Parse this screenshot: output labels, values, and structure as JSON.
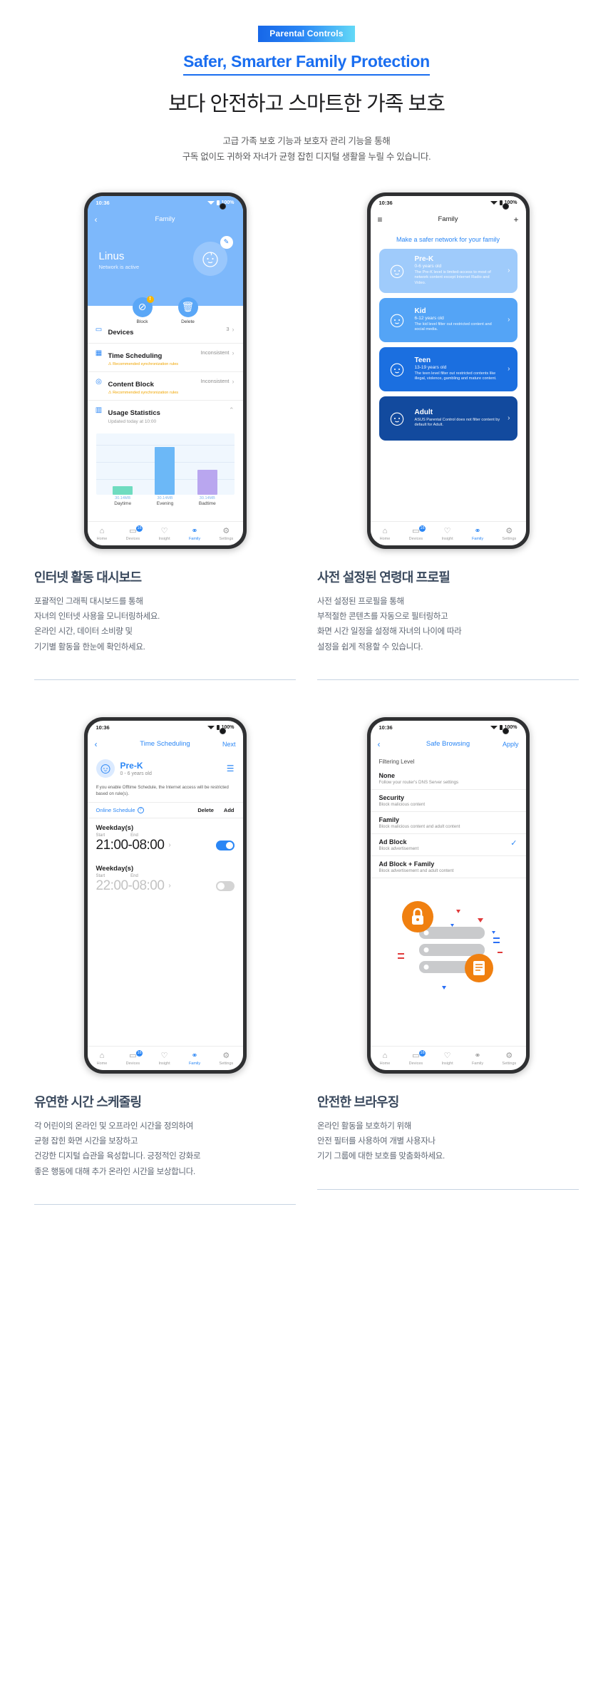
{
  "hero": {
    "badge": "Parental Controls",
    "title_en": "Safer, Smarter Family Protection",
    "title_ko": "보다 안전하고 스마트한 가족 보호",
    "desc_line1": "고급 가족 보호 기능과 보호자 관리 기능을 통해",
    "desc_line2": "구독 없이도 귀하와 자녀가 균형 잡힌 디지털 생활을 누릴 수 있습니다."
  },
  "phone1": {
    "status_time": "10:36",
    "status_battery": "100%",
    "nav_back": "‹",
    "nav_title": "Family",
    "profile_name": "Linus",
    "profile_status": "Network is active",
    "edit_icon": "✎",
    "actions": [
      {
        "label": "Block",
        "icon": "⊘",
        "badge": "!"
      },
      {
        "label": "Delete",
        "icon": "🗑",
        "badge": ""
      }
    ],
    "rows": [
      {
        "icon": "▭",
        "title": "Devices",
        "warn": "",
        "sub": "",
        "right": "3",
        "chev": "›"
      },
      {
        "icon": "▦",
        "title": "Time Scheduling",
        "warn": "⚠ Recommended synchronization rules",
        "sub": "",
        "right": "Inconsistent",
        "chev": "›"
      },
      {
        "icon": "◎",
        "title": "Content Block",
        "warn": "⚠ Recommended synchronization rules",
        "sub": "",
        "right": "Inconsistent",
        "chev": "›"
      },
      {
        "icon": "▥",
        "title": "Usage Statistics",
        "warn": "",
        "sub": "Updated today at 10:00",
        "right": "",
        "chev": "⌃"
      }
    ],
    "chart_data": {
      "type": "bar",
      "title": "Usage Statistics",
      "subtitle": "Updated today at 10:00",
      "categories": [
        "Daytime",
        "Evening",
        "Badtime"
      ],
      "values": [
        18,
        100,
        52
      ],
      "value_labels": [
        "30.14MB",
        "30.14MB",
        "30.14MB"
      ],
      "colors": [
        "#6fdcc0",
        "#6cb8f7",
        "#b9a6ef"
      ],
      "xlabel": "",
      "ylabel": "",
      "grid": true
    },
    "tabs": [
      {
        "icon": "⌂",
        "label": "Home",
        "badge": "",
        "active": false
      },
      {
        "icon": "▭",
        "label": "Devices",
        "badge": "16",
        "active": false
      },
      {
        "icon": "♡",
        "label": "Insight",
        "badge": "",
        "active": false
      },
      {
        "icon": "⚭",
        "label": "Family",
        "badge": "",
        "active": true
      },
      {
        "icon": "⚙",
        "label": "Settings",
        "badge": "",
        "active": false
      }
    ]
  },
  "phone2": {
    "status_time": "10:36",
    "status_battery": "100%",
    "nav_menu": "≡",
    "nav_title": "Family",
    "nav_add": "+",
    "headline": "Make a safer network for your family",
    "cards": [
      {
        "name": "Pre-K",
        "age": "0-6 years old",
        "desc": "The Pre-K level is limited-access to most of network content except Internet Radio and Video.",
        "bg": "#9fcbfb",
        "face": "◕"
      },
      {
        "name": "Kid",
        "age": "6-12 years old",
        "desc": "The kid level filter out restricted content and social media.",
        "bg": "#54a4f6",
        "face": "◕"
      },
      {
        "name": "Teen",
        "age": "13-19 years old",
        "desc": "The teen level filter out restricted contents like illegal, violence, gambling and mature content.",
        "bg": "#1b6fe0",
        "face": "◕"
      },
      {
        "name": "Adult",
        "age": "",
        "desc": "ASUS Parental Control does not filter content by default for Adult.",
        "bg": "#124a9e",
        "face": "◕"
      }
    ],
    "tabs": [
      {
        "icon": "⌂",
        "label": "Home",
        "badge": "",
        "active": false
      },
      {
        "icon": "▭",
        "label": "Devices",
        "badge": "16",
        "active": false
      },
      {
        "icon": "♡",
        "label": "Insight",
        "badge": "",
        "active": false
      },
      {
        "icon": "⚭",
        "label": "Family",
        "badge": "",
        "active": true
      },
      {
        "icon": "⚙",
        "label": "Settings",
        "badge": "",
        "active": false
      }
    ]
  },
  "phone3": {
    "status_time": "10:36",
    "status_battery": "100%",
    "nav_back": "‹",
    "nav_title": "Time Scheduling",
    "nav_action": "Next",
    "profile_name": "Pre-K",
    "profile_age": "0 - 6 years old",
    "list_icon": "☰",
    "note": "If you enable Offtime Schedule, the Internet access will be restricted based on rule(s).",
    "tool_link": "Online Schedule",
    "tool_info": "?",
    "tool_delete": "Delete",
    "tool_add": "Add",
    "schedules": [
      {
        "heading": "Weekday(s)",
        "start_label": "Start",
        "end_label": "End",
        "time": "21:00-08:00",
        "chev": "›",
        "enabled": true
      },
      {
        "heading": "Weekday(s)",
        "start_label": "Start",
        "end_label": "End",
        "time": "22:00-08:00",
        "chev": "›",
        "enabled": false
      }
    ],
    "tabs": [
      {
        "icon": "⌂",
        "label": "Home",
        "badge": "",
        "active": false
      },
      {
        "icon": "▭",
        "label": "Devices",
        "badge": "16",
        "active": false
      },
      {
        "icon": "♡",
        "label": "Insight",
        "badge": "",
        "active": false
      },
      {
        "icon": "⚭",
        "label": "Family",
        "badge": "",
        "active": true
      },
      {
        "icon": "⚙",
        "label": "Settings",
        "badge": "",
        "active": false
      }
    ]
  },
  "phone4": {
    "status_time": "10:36",
    "status_battery": "100%",
    "nav_back": "‹",
    "nav_title": "Safe Browsing",
    "nav_action": "Apply",
    "section_label": "Filtering Level",
    "options": [
      {
        "title": "None",
        "sub": "Follow your router's DNS  Server settings",
        "checked": false
      },
      {
        "title": "Security",
        "sub": "Block malicious content",
        "checked": false
      },
      {
        "title": "Family",
        "sub": "Block malicious content and adult content",
        "checked": false
      },
      {
        "title": "Ad Block",
        "sub": "Block advertisement",
        "checked": true
      },
      {
        "title": "Ad Block + Family",
        "sub": "Block advertisement and adult content",
        "checked": false
      }
    ],
    "check_glyph": "✓",
    "tabs": [
      {
        "icon": "⌂",
        "label": "Home",
        "badge": "",
        "active": false
      },
      {
        "icon": "▭",
        "label": "Devices",
        "badge": "16",
        "active": false
      },
      {
        "icon": "♡",
        "label": "Insight",
        "badge": "",
        "active": false
      },
      {
        "icon": "⚭",
        "label": "Family",
        "badge": "",
        "active": false
      },
      {
        "icon": "⚙",
        "label": "Settings",
        "badge": "",
        "active": false
      }
    ]
  },
  "captions": [
    {
      "heading": "인터넷 활동 대시보드",
      "body": "포괄적인 그래픽 대시보드를 통해\n자녀의 인터넷 사용을 모니터링하세요.\n온라인 시간, 데이터 소비량 및\n기기별 활동을 한눈에 확인하세요."
    },
    {
      "heading": "사전 설정된 연령대 프로필",
      "body": "사전 설정된 프로필을 통해\n부적절한 콘텐츠를 자동으로 필터링하고\n화면 시간 일정을 설정해 자녀의 나이에 따라\n설정을 쉽게 적용할 수 있습니다."
    },
    {
      "heading": "유연한 시간 스케줄링",
      "body": "각 어린이의 온라인 및 오프라인 시간을 정의하여\n균형 잡힌 화면 시간을 보장하고\n건강한 디지털 습관을 육성합니다. 긍정적인 강화로\n좋은 행동에 대해 추가 온라인 시간을 보상합니다."
    },
    {
      "heading": "안전한 브라우징",
      "body": "온라인 활동을 보호하기 위해\n안전 필터를 사용하여 개별 사용자나\n기기 그룹에 대한 보호를 맞춤화하세요."
    }
  ],
  "colors": {
    "accent": "#1a6ef0",
    "heading": "#3b4a5e",
    "phone_blue": "#7db8fb",
    "orange": "#f08010"
  }
}
